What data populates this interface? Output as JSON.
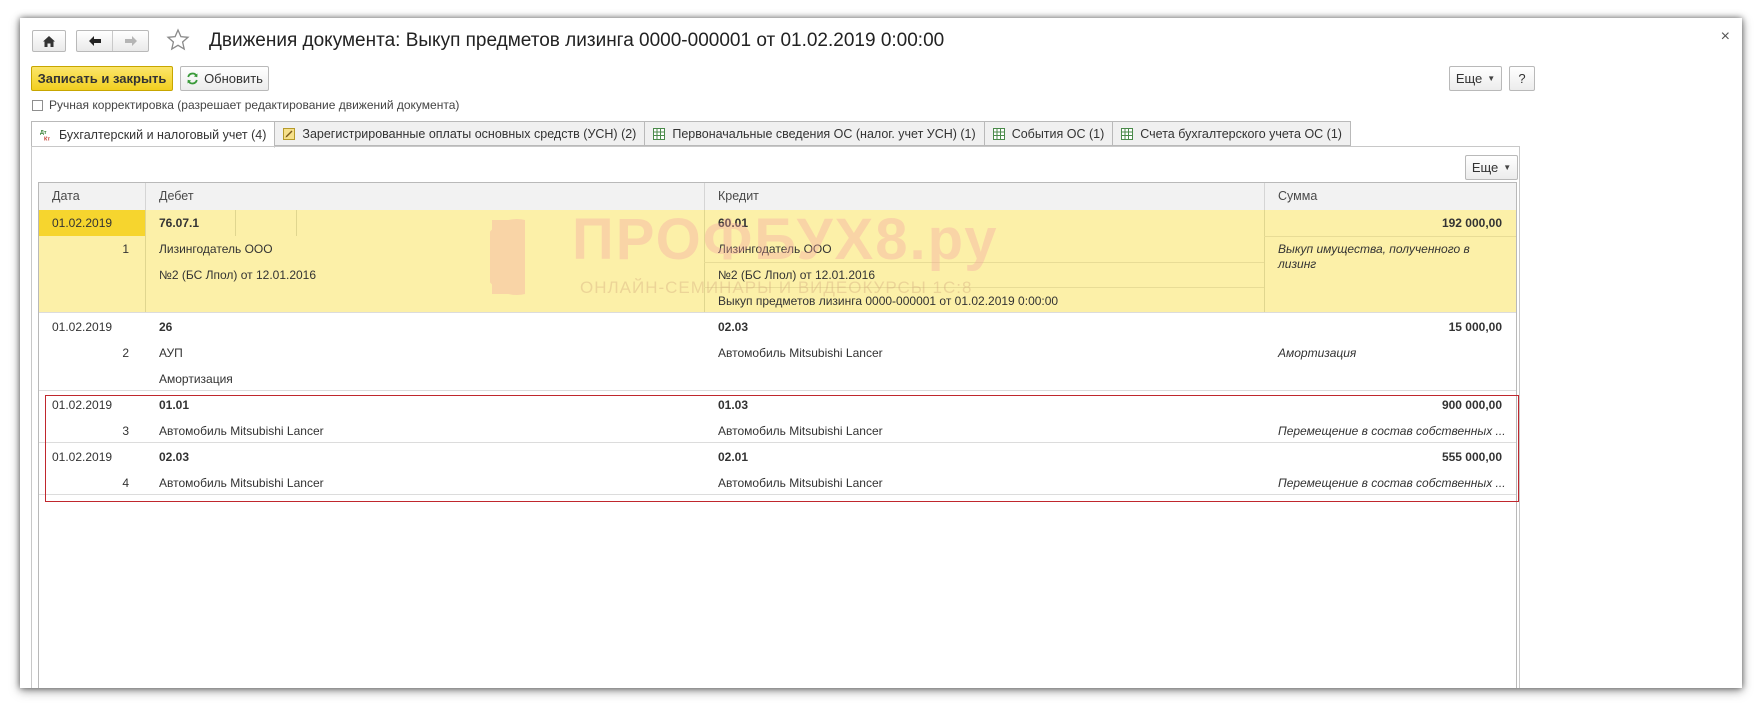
{
  "window": {
    "title": "Движения документа: Выкуп предметов лизинга 0000-000001 от 01.02.2019 0:00:00",
    "close": "×"
  },
  "toolbar": {
    "save_close": "Записать и закрыть",
    "refresh": "Обновить",
    "more": "Еще",
    "help": "?"
  },
  "manual_correction": "Ручная корректировка (разрешает редактирование движений документа)",
  "tabs": [
    {
      "label": "Бухгалтерский и налоговый учет (4)",
      "icon": "accounting-icon",
      "active": true
    },
    {
      "label": "Зарегистрированные оплаты основных средств (УСН) (2)",
      "icon": "register-icon"
    },
    {
      "label": "Первоначальные сведения ОС (налог. учет УСН) (1)",
      "icon": "table-icon"
    },
    {
      "label": "События ОС (1)",
      "icon": "table-icon"
    },
    {
      "label": "Счета бухгалтерского учета ОС (1)",
      "icon": "table-icon"
    }
  ],
  "table": {
    "more": "Еще",
    "columns": {
      "date": "Дата",
      "debit": "Дебет",
      "credit": "Кредит",
      "sum": "Сумма"
    },
    "rows": [
      {
        "date": "01.02.2019",
        "num": "1",
        "debit_account": "76.07.1",
        "debit_sub1": "Лизингодатель ООО",
        "debit_sub2": "№2 (БС Лпол) от 12.01.2016",
        "debit_sub3": "",
        "credit_account": "60.01",
        "credit_sub1": "Лизингодатель ООО",
        "credit_sub2": "№2 (БС Лпол) от 12.01.2016",
        "credit_sub3": "Выкуп предметов лизинга 0000-000001 от 01.02.2019 0:00:00",
        "amount": "192 000,00",
        "content_line1": "Выкуп имущества, полученного в",
        "content_line2": "лизинг"
      },
      {
        "date": "01.02.2019",
        "num": "2",
        "debit_account": "26",
        "debit_sub1": "АУП",
        "debit_sub2": "Амортизация",
        "credit_account": "02.03",
        "credit_sub1": "Автомобиль Mitsubishi Lancer",
        "amount": "15 000,00",
        "content_line1": "Амортизация"
      },
      {
        "date": "01.02.2019",
        "num": "3",
        "debit_account": "01.01",
        "debit_sub1": "Автомобиль Mitsubishi Lancer",
        "credit_account": "01.03",
        "credit_sub1": "Автомобиль Mitsubishi Lancer",
        "amount": "900 000,00",
        "content_line1": "Перемещение в состав собственных ..."
      },
      {
        "date": "01.02.2019",
        "num": "4",
        "debit_account": "02.03",
        "debit_sub1": "Автомобиль Mitsubishi Lancer",
        "credit_account": "02.01",
        "credit_sub1": "Автомобиль Mitsubishi Lancer",
        "amount": "555 000,00",
        "content_line1": "Перемещение в состав собственных ..."
      }
    ]
  },
  "watermark": {
    "title": "ПРОФБУХ8.ру",
    "subtitle": "ОНЛАЙН-СЕМИНАРЫ И ВИДЕОКУРСЫ 1С:8"
  },
  "colors": {
    "primary_button": "#f2cf1f",
    "selected_row": "#fcf0a8",
    "selected_date": "#f6d52e",
    "highlight_border": "#c0272d"
  }
}
